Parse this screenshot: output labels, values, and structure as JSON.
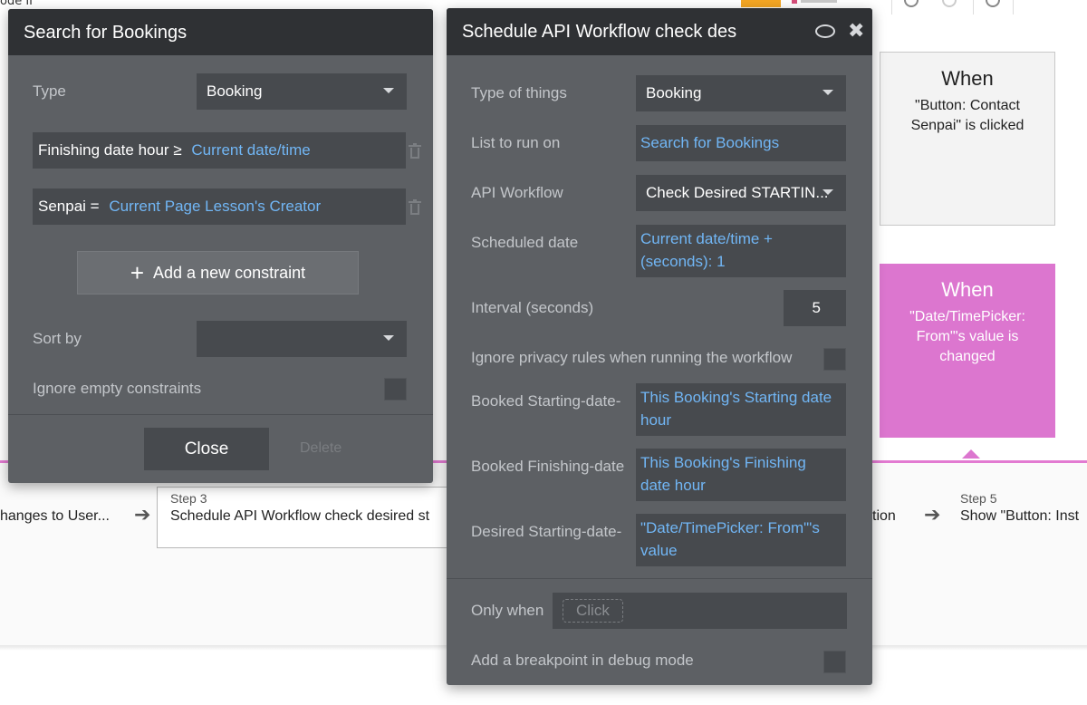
{
  "background": {
    "top_fragment": "ode II",
    "events": [
      {
        "title": "When",
        "description": "\"Button: Contact Senpai\" is clicked"
      },
      {
        "title": "When",
        "description": "\"Date/TimePicker: From\"'s value is changed"
      }
    ],
    "steps": {
      "previous_name": "hanges to User...",
      "step3_label": "Step 3",
      "step3_name": "Schedule API Workflow check desired st",
      "step4_name_fragment": "tion",
      "step5_label": "Step 5",
      "step5_name": "Show \"Button: Inst"
    },
    "colors": {
      "accent_pink": "#dc76cf",
      "link_blue": "#71b6f5",
      "panel_dark": "#5d6064",
      "panel_header": "#2f3134"
    }
  },
  "search_panel": {
    "title": "Search for Bookings",
    "type_label": "Type",
    "type_value": "Booking",
    "constraints": [
      {
        "field": "Finishing date hour ≥",
        "value": "Current date/time"
      },
      {
        "field": "Senpai =",
        "value": "Current Page Lesson's Creator"
      }
    ],
    "add_constraint_label": "Add a new constraint",
    "sort_label": "Sort by",
    "sort_value": "",
    "ignore_empty_label": "Ignore empty constraints",
    "ignore_empty_checked": false,
    "close_label": "Close",
    "delete_label": "Delete"
  },
  "schedule_panel": {
    "title": "Schedule API Workflow check des",
    "rows": {
      "type_of_things_label": "Type of things",
      "type_of_things_value": "Booking",
      "list_label": "List to run on",
      "list_value": "Search for Bookings",
      "api_workflow_label": "API Workflow",
      "api_workflow_value": "Check Desired STARTIN...",
      "scheduled_date_label": "Scheduled date",
      "scheduled_date_line1": "Current date/time +",
      "scheduled_date_line2": "(seconds): 1",
      "interval_label": "Interval (seconds)",
      "interval_value": "5",
      "ignore_privacy_label": "Ignore privacy rules when running the workflow",
      "booked_starting_label": "Booked Starting-date-",
      "booked_starting_line1": "This Booking's Starting date",
      "booked_starting_line2": "hour",
      "booked_finishing_label": "Booked Finishing-date",
      "booked_finishing_line1": "This Booking's Finishing",
      "booked_finishing_line2": "date hour",
      "desired_starting_label": "Desired Starting-date-",
      "desired_starting_line1": "\"Date/TimePicker: From\"'s",
      "desired_starting_line2": "value",
      "only_when_label": "Only when",
      "only_when_placeholder": "Click",
      "breakpoint_label": "Add a breakpoint in debug mode"
    }
  }
}
